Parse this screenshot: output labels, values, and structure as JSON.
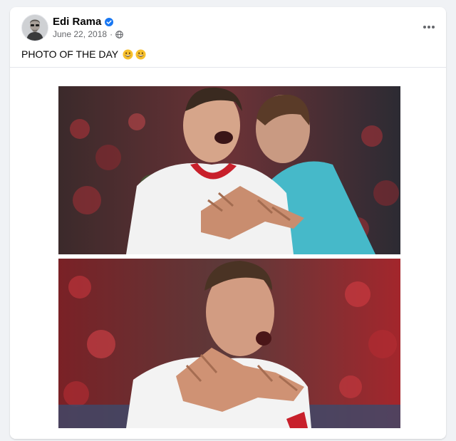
{
  "post": {
    "author": "Edi Rama",
    "date": "June 22, 2018",
    "separator": "·",
    "caption": "PHOTO OF THE DAY",
    "emojis": [
      "grinning-face-icon",
      "grinning-face-icon"
    ],
    "audience_icon": "globe-icon",
    "verified_icon": "verified-badge-icon",
    "menu_icon": "more-options-icon"
  },
  "colors": {
    "verified": "#1877f2",
    "name": "#050505",
    "meta": "#65676b",
    "background": "#f0f2f5"
  }
}
